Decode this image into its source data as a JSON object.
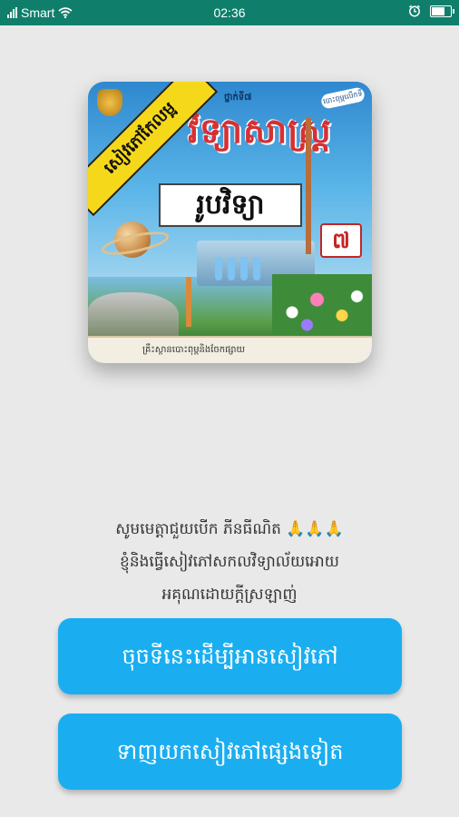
{
  "status_bar": {
    "carrier": "Smart",
    "time": "02:36",
    "wifi_icon": "wifi-icon",
    "signal_icon": "signal-icon",
    "alarm_icon": "alarm-icon",
    "battery_icon": "battery-icon",
    "battery_level": 0.8,
    "background": "#0f7f6c"
  },
  "cover": {
    "ribbon_text": "សៀវភៅកែលម្អ",
    "top_text": "ថ្នាក់ទី៧",
    "title": "វិទ្យាសាស្ត្រ",
    "subject": "រូបវិទ្យា",
    "grade": "៧",
    "publisher": "គ្រឹះស្ថានបោះពុម្ពនិងចែកផ្សាយ",
    "corner_tag": "បោះពុម្ពលើកទី"
  },
  "message": {
    "line1": "សូមមេត្តាជួយបើក ភីនធីណិត 🙏🙏🙏",
    "line2": "ខ្ញុំនិងធ្វើសៀវភៅសកលវិទ្យាល័យអោយ",
    "line3": "អគុណដោយក្ដីស្រឡាញ់"
  },
  "buttons": {
    "read_label": "ចុចទីនេះដើម្បីអានសៀវភៅ",
    "download_label": "ទាញយកសៀវភៅផ្សេងទៀត",
    "color": "#1aaef0"
  }
}
